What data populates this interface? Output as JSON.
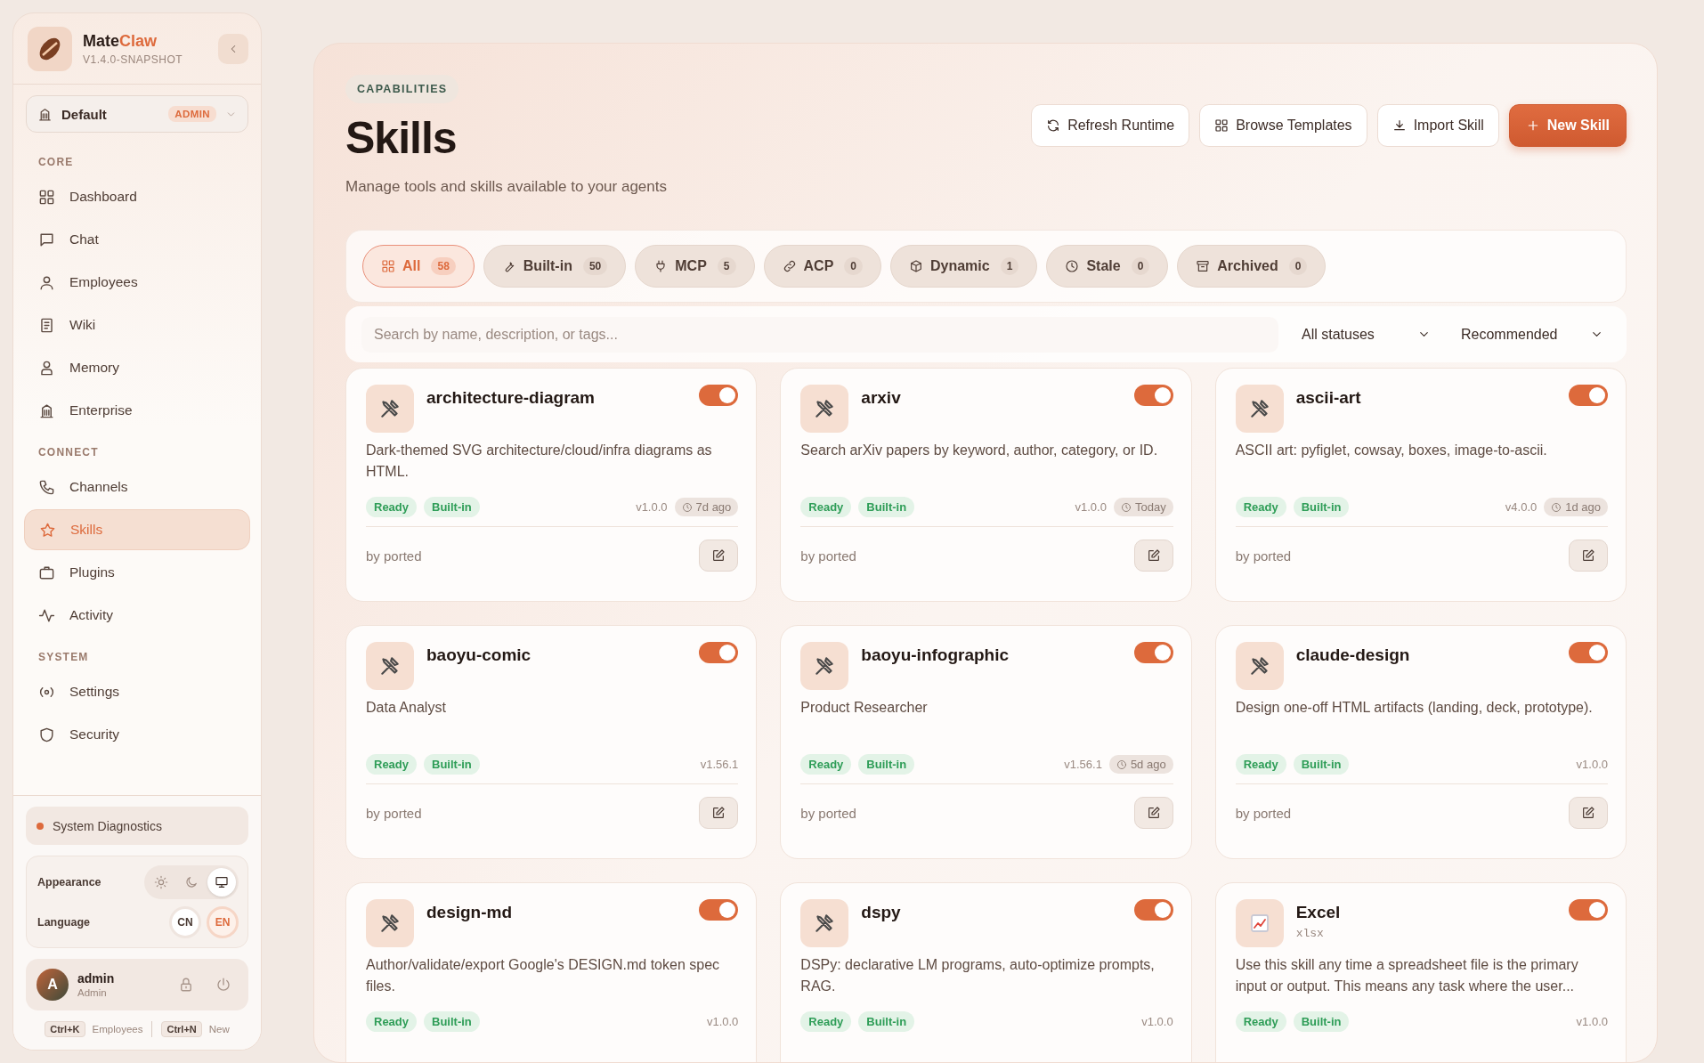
{
  "sidebar": {
    "brand": {
      "name": "Mate",
      "accent": "Claw",
      "version": "V1.4.0-SNAPSHOT"
    },
    "workspace": {
      "name": "Default",
      "role": "ADMIN"
    },
    "sections": [
      {
        "title": "CORE",
        "items": [
          {
            "label": "Dashboard",
            "selected": false
          },
          {
            "label": "Chat",
            "selected": false
          },
          {
            "label": "Employees",
            "selected": false
          },
          {
            "label": "Wiki",
            "selected": false
          },
          {
            "label": "Memory",
            "selected": false
          },
          {
            "label": "Enterprise",
            "selected": false
          }
        ]
      },
      {
        "title": "CONNECT",
        "items": [
          {
            "label": "Channels",
            "selected": false
          },
          {
            "label": "Skills",
            "selected": true
          },
          {
            "label": "Plugins",
            "selected": false
          },
          {
            "label": "Activity",
            "selected": false
          }
        ]
      },
      {
        "title": "SYSTEM",
        "items": [
          {
            "label": "Settings",
            "selected": false
          },
          {
            "label": "Security",
            "selected": false
          }
        ]
      }
    ],
    "diagnostics": {
      "label": "System Diagnostics"
    },
    "appearance": {
      "label": "Appearance",
      "options": [
        {
          "selected": false
        },
        {
          "selected": false
        },
        {
          "selected": true
        }
      ]
    },
    "language": {
      "label": "Language",
      "options": [
        {
          "label": "CN",
          "selected": false
        },
        {
          "label": "EN",
          "selected": true
        }
      ]
    },
    "user": {
      "initial": "A",
      "name": "admin",
      "role": "Admin"
    },
    "shortcuts": [
      {
        "key": "Ctrl+K",
        "label": "Employees"
      },
      {
        "key": "Ctrl+N",
        "label": "New"
      }
    ]
  },
  "header": {
    "eyebrow": "CAPABILITIES",
    "title": "Skills",
    "subtitle": "Manage tools and skills available to your agents",
    "buttons": [
      {
        "label": "Refresh Runtime",
        "kind": "default"
      },
      {
        "label": "Browse Templates",
        "kind": "default"
      },
      {
        "label": "Import Skill",
        "kind": "default"
      },
      {
        "label": "New Skill",
        "kind": "primary"
      }
    ]
  },
  "tabs": [
    {
      "label": "All",
      "count": "58",
      "selected": true
    },
    {
      "label": "Built-in",
      "count": "50",
      "selected": false
    },
    {
      "label": "MCP",
      "count": "5",
      "selected": false
    },
    {
      "label": "ACP",
      "count": "0",
      "selected": false
    },
    {
      "label": "Dynamic",
      "count": "1",
      "selected": false
    },
    {
      "label": "Stale",
      "count": "0",
      "selected": false
    },
    {
      "label": "Archived",
      "count": "0",
      "selected": false
    }
  ],
  "filters": {
    "search": {
      "placeholder": "Search by name, description, or tags..."
    },
    "status": "All statuses",
    "sort": "Recommended"
  },
  "cards": [
    {
      "kind": "tool",
      "name": "architecture-diagram",
      "enabled": true,
      "description": "Dark-themed SVG architecture/cloud/infra diagrams as HTML.",
      "tags": [
        "Ready",
        "Built-in"
      ],
      "version": "v1.0.0",
      "updated": "7d ago",
      "author": "by ported"
    },
    {
      "kind": "tool",
      "name": "arxiv",
      "enabled": true,
      "description": "Search arXiv papers by keyword, author, category, or ID.",
      "tags": [
        "Ready",
        "Built-in"
      ],
      "version": "v1.0.0",
      "updated": "Today",
      "author": "by ported"
    },
    {
      "kind": "tool",
      "name": "ascii-art",
      "enabled": true,
      "description": "ASCII art: pyfiglet, cowsay, boxes, image-to-ascii.",
      "tags": [
        "Ready",
        "Built-in"
      ],
      "version": "v4.0.0",
      "updated": "1d ago",
      "author": "by ported"
    },
    {
      "kind": "tool",
      "name": "baoyu-comic",
      "enabled": true,
      "description": "Data Analyst",
      "tags": [
        "Ready",
        "Built-in"
      ],
      "version": "v1.56.1",
      "author": "by ported"
    },
    {
      "kind": "tool",
      "name": "baoyu-infographic",
      "enabled": true,
      "description": "Product Researcher",
      "tags": [
        "Ready",
        "Built-in"
      ],
      "version": "v1.56.1",
      "updated": "5d ago",
      "author": "by ported"
    },
    {
      "kind": "tool",
      "name": "claude-design",
      "enabled": true,
      "description": "Design one-off HTML artifacts (landing, deck, prototype).",
      "tags": [
        "Ready",
        "Built-in"
      ],
      "version": "v1.0.0",
      "author": "by ported"
    },
    {
      "kind": "tool",
      "name": "design-md",
      "enabled": true,
      "description": "Author/validate/export Google's DESIGN.md token spec files.",
      "tags": [
        "Ready",
        "Built-in"
      ],
      "version": "v1.0.0"
    },
    {
      "kind": "tool",
      "name": "dspy",
      "enabled": true,
      "description": "DSPy: declarative LM programs, auto-optimize prompts, RAG.",
      "tags": [
        "Ready",
        "Built-in"
      ],
      "version": "v1.0.0"
    },
    {
      "kind": "chart",
      "name": "Excel",
      "subtitle": "xlsx",
      "enabled": true,
      "description": "Use this skill any time a spreadsheet file is the primary input or output. This means any task where the user...",
      "tags": [
        "Ready",
        "Built-in"
      ],
      "version": "v1.0.0"
    }
  ]
}
